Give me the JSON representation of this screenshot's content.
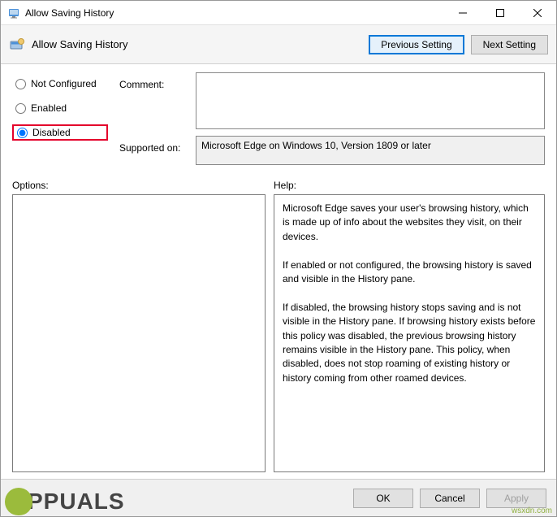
{
  "titlebar": {
    "title": "Allow Saving History"
  },
  "header": {
    "title": "Allow Saving History",
    "previous_label": "Previous Setting",
    "next_label": "Next Setting"
  },
  "radios": {
    "not_configured": "Not Configured",
    "enabled": "Enabled",
    "disabled": "Disabled",
    "selected": "disabled"
  },
  "fields": {
    "comment_label": "Comment:",
    "comment_value": "",
    "supported_label": "Supported on:",
    "supported_value": "Microsoft Edge on Windows 10, Version 1809 or later"
  },
  "labels": {
    "options": "Options:",
    "help": "Help:"
  },
  "help_text": "Microsoft Edge saves your user's browsing history, which is made up of info about the websites they visit, on their devices.\n\nIf enabled or not configured, the browsing history is saved and visible in the History pane.\n\nIf disabled, the browsing history stops saving and is not visible in the History pane. If browsing history exists before this policy was disabled, the previous browsing history remains visible in the History pane. This policy, when disabled, does not stop roaming of existing history or history coming from other roamed devices.",
  "footer": {
    "ok": "OK",
    "cancel": "Cancel",
    "apply": "Apply"
  },
  "watermark": {
    "text": "PPUALS",
    "credit": "wsxdn.com"
  }
}
